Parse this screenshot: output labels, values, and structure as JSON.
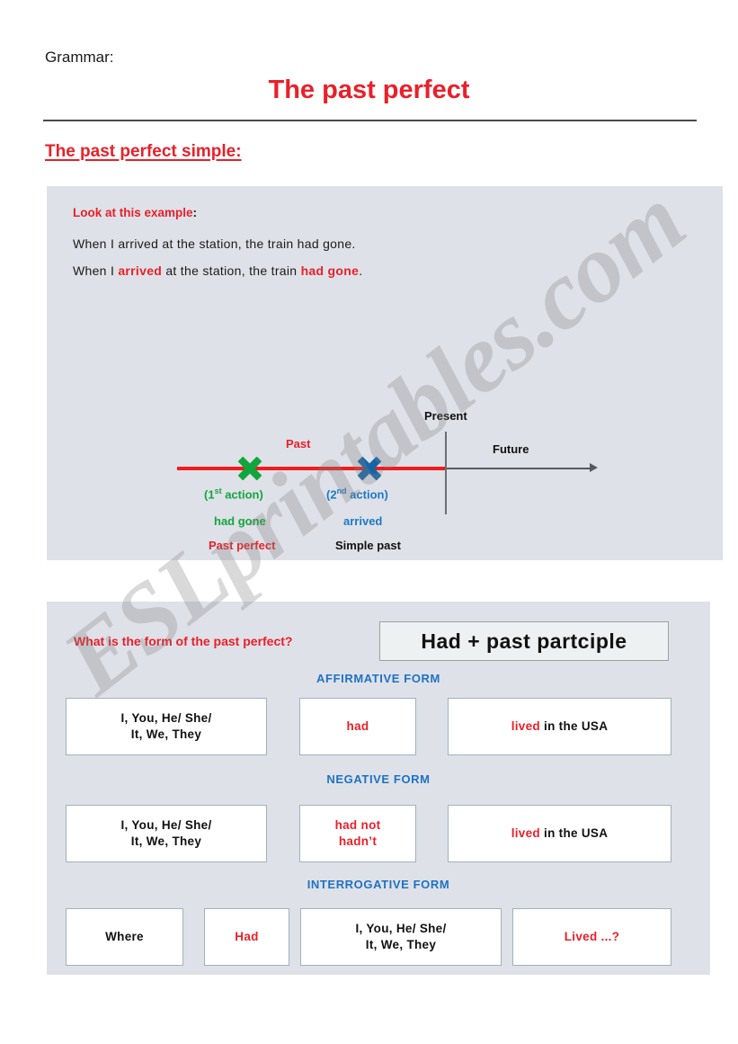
{
  "header": {
    "grammar_label": "Grammar:",
    "title": "The past perfect",
    "subtitle": "The past perfect simple:"
  },
  "example": {
    "heading": "Look at this example",
    "heading_colon": ":",
    "line1": "When I arrived at the station, the train had gone.",
    "line2_parts": {
      "a": "When I ",
      "b": "arrived",
      "c": " at the station, the train ",
      "d": "had gone",
      "e": "."
    }
  },
  "timeline": {
    "past": "Past",
    "present": "Present",
    "future": "Future",
    "first_action_open": "(1",
    "first_action_ord": "st",
    "first_action_close": " action)",
    "second_action_open": "(2",
    "second_action_ord": "nd",
    "second_action_close": " action)",
    "had_gone": "had gone",
    "arrived": "arrived",
    "past_perfect": "Past perfect",
    "simple_past": "Simple past"
  },
  "forms": {
    "question": "What is the form of the past perfect?",
    "formula": "Had +  past partciple",
    "labels": {
      "affirmative": "AFFIRMATIVE FORM",
      "negative": "NEGATIVE FORM",
      "interrogative": "INTERROGATIVE FORM"
    },
    "subject_line1": "I, You, He/  She/",
    "subject_line2": "It, We, They",
    "affirmative": {
      "aux": "had",
      "rest_verb": "lived",
      "rest_tail": " in the USA"
    },
    "negative": {
      "aux_line1": "had not",
      "aux_line2": "hadn’t",
      "rest_verb": "lived",
      "rest_tail": " in the USA"
    },
    "interrogative": {
      "wh": "Where",
      "aux": "Had",
      "rest": "Lived ...?"
    }
  },
  "watermark": {
    "text": "ESLprintables.com"
  },
  "colors": {
    "red": "#e8202a",
    "blue": "#1d72c4",
    "green": "#11a63d",
    "panel_bg": "#dfe1e8"
  }
}
